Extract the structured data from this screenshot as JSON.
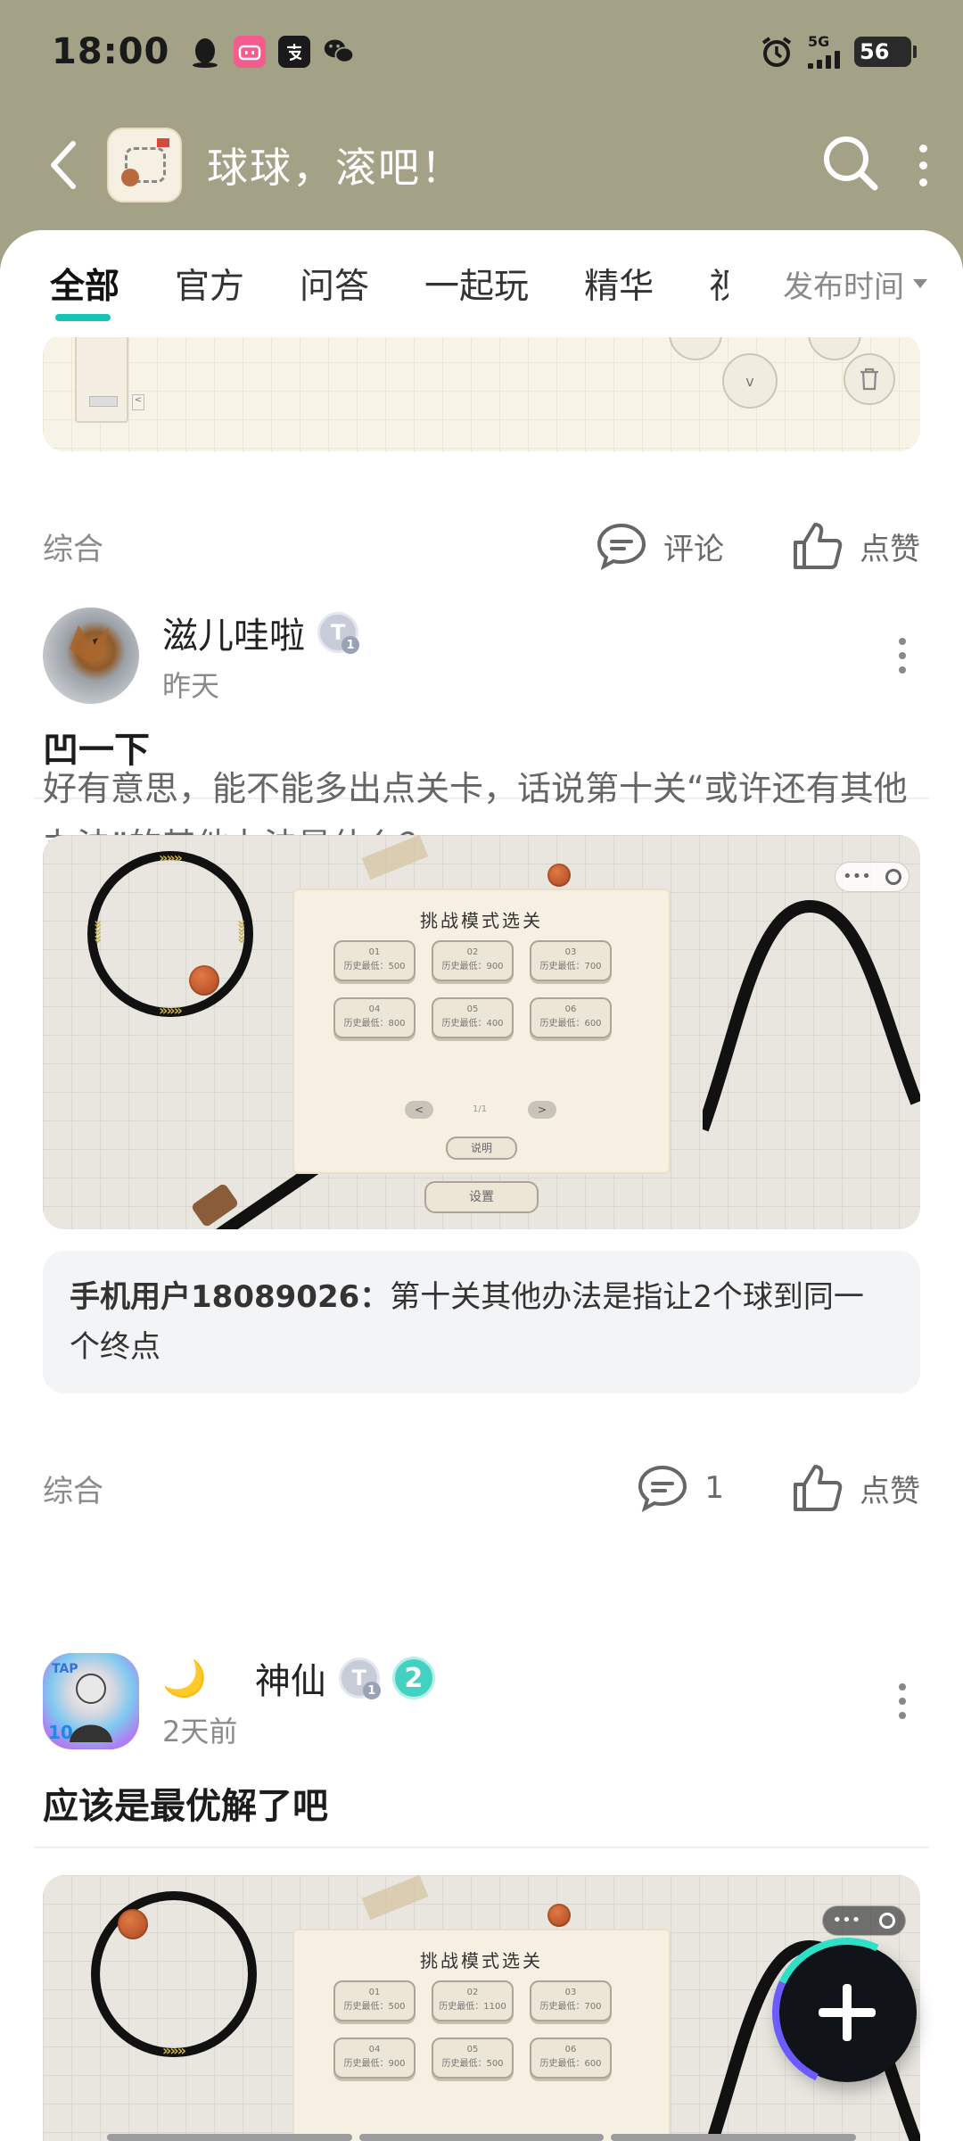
{
  "status_bar": {
    "time": "18:00",
    "network": "5G",
    "battery": "56",
    "left_icons": [
      "qq-icon",
      "bilibili-icon",
      "alipay-icon",
      "wechat-icon"
    ]
  },
  "header": {
    "title": "球球，滚吧！"
  },
  "tabs": [
    {
      "label": "全部",
      "active": true
    },
    {
      "label": "官方"
    },
    {
      "label": "问答"
    },
    {
      "label": "一起玩"
    },
    {
      "label": "精华"
    },
    {
      "label": "视"
    }
  ],
  "sort": {
    "label": "发布时间"
  },
  "posts": [
    {
      "tag": "综合",
      "comment_label": "评论",
      "like_label": "点赞"
    },
    {
      "author": "滋儿哇啦",
      "time": "昨天",
      "title": "凹一下",
      "body": "好有意思，能不能多出点关卡，话说第十关“或许还有其他办法”的其他办法是什么？",
      "image": {
        "panel_title": "挑战模式选关",
        "levels": [
          {
            "num": "01",
            "record": "历史最低：500"
          },
          {
            "num": "02",
            "record": "历史最低：900"
          },
          {
            "num": "03",
            "record": "历史最低：700"
          },
          {
            "num": "04",
            "record": "历史最低：800"
          },
          {
            "num": "05",
            "record": "历史最低：400"
          },
          {
            "num": "06",
            "record": "历史最低：600"
          }
        ],
        "pager": "1/1",
        "prev": "<",
        "next": ">",
        "info_btn": "说明",
        "settings_btn": "设置"
      },
      "comment": {
        "name": "手机用户18089026：",
        "text": "第十关其他办法是指让2个球到同一个终点"
      },
      "tag": "综合",
      "comment_count": "1",
      "like_label": "点赞"
    },
    {
      "author_prefix": "🌙",
      "author": "神仙",
      "level": "2",
      "time": "2天前",
      "title": "应该是最优解了吧",
      "image": {
        "panel_title": "挑战模式选关",
        "levels": [
          {
            "num": "01",
            "record": "历史最低：500"
          },
          {
            "num": "02",
            "record": "历史最低：1100"
          },
          {
            "num": "03",
            "record": "历史最低：700"
          },
          {
            "num": "04",
            "record": "历史最低：900"
          },
          {
            "num": "05",
            "record": "历史最低：500"
          },
          {
            "num": "06",
            "record": "历史最低：600"
          }
        ]
      }
    }
  ],
  "colors": {
    "header_bg": "#a3a287",
    "accent": "#14c4b4",
    "level_badge": "#43d1c2"
  }
}
